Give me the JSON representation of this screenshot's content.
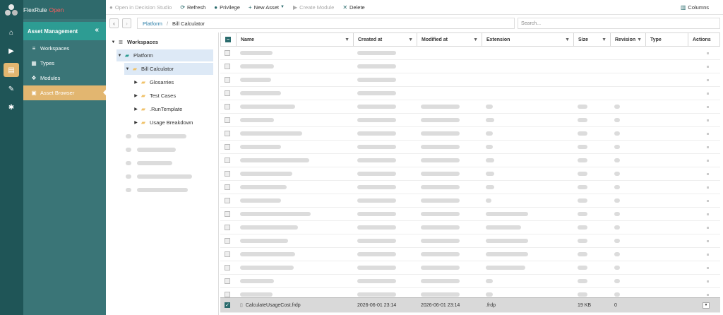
{
  "app": {
    "name": "FlexRule",
    "edition": "Open"
  },
  "rail": {
    "items": [
      "home-icon",
      "play-icon",
      "book-icon",
      "pencil-icon",
      "gear-icon"
    ]
  },
  "side": {
    "section": "Asset Management",
    "items": [
      {
        "label": "Workspaces",
        "icon": "database-icon"
      },
      {
        "label": "Types",
        "icon": "table-icon"
      },
      {
        "label": "Modules",
        "icon": "cubes-icon"
      },
      {
        "label": "Asset Browser",
        "icon": "browser-icon"
      }
    ]
  },
  "toolbar": {
    "open": "Open in Decision Studio",
    "refresh": "Refresh",
    "privilege": "Privilege",
    "new_asset": "New Asset",
    "create_module": "Create Module",
    "delete": "Delete",
    "columns": "Columns"
  },
  "breadcrumb": {
    "root": "Platform",
    "current": "Bill Calculator"
  },
  "search": {
    "placeholder": "Search..."
  },
  "tree": {
    "workspaces": "Workspaces",
    "platform": "Platform",
    "bill": "Bill Calculator",
    "children": [
      "Glosarries",
      "Test Cases",
      ".RunTemplate",
      "Usage Breakdown"
    ]
  },
  "grid": {
    "headers": {
      "name": "Name",
      "created": "Created at",
      "modified": "Modified at",
      "extension": "Extension",
      "size": "Size",
      "revision": "Revision",
      "type": "Type",
      "actions": "Actions"
    },
    "selected_row": {
      "name": "CalculateUsageCost.frdp",
      "created": "2026-06-01 23:14",
      "modified": "2026-06-01 23:14",
      "extension": ".frdp",
      "size": "19 KB",
      "revision": "0"
    }
  },
  "colors": {
    "rail": "#1f5557",
    "side": "#3a7577",
    "section": "#2d9c93",
    "active": "#e2b670",
    "link": "#2a7ea8"
  }
}
